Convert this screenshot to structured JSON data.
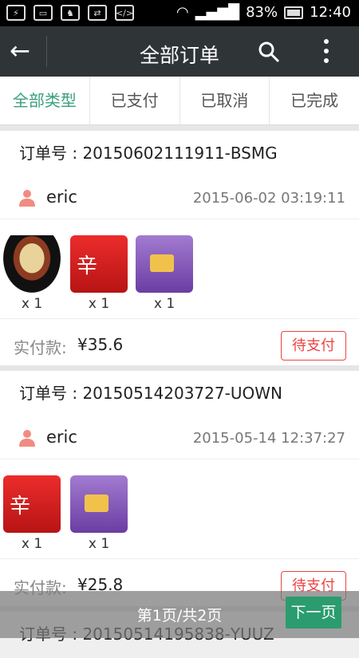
{
  "status": {
    "battery": "83%",
    "time": "12:40"
  },
  "header": {
    "back": "←",
    "title": "全部订单"
  },
  "tabs": [
    "全部类型",
    "已支付",
    "已取消",
    "已完成"
  ],
  "orders": [
    {
      "order_label": "订单号 : ",
      "order_no": "20150602111911-BSMG",
      "user": "eric",
      "date": "2015-06-02 03:19:11",
      "pay_label": "实付款:",
      "amount": "¥35.6",
      "status": "待支付",
      "items": [
        {
          "qty": "x 1"
        },
        {
          "qty": "x 1"
        },
        {
          "qty": "x 1"
        }
      ]
    },
    {
      "order_label": "订单号 : ",
      "order_no": "20150514203727-UOWN",
      "user": "eric",
      "date": "2015-05-14 12:37:27",
      "pay_label": "实付款:",
      "amount": "¥25.8",
      "status": "待支付",
      "items": [
        {
          "qty": "x 1"
        },
        {
          "qty": "x 1"
        }
      ]
    },
    {
      "order_label": "订单号 : ",
      "order_no": "20150514195838-YUUZ"
    }
  ],
  "pager": {
    "text": "第1页/共2页",
    "next": "下一页"
  },
  "colors": {
    "accent": "#3aa07a",
    "alert": "#e44444",
    "appbar": "#2f3437"
  }
}
